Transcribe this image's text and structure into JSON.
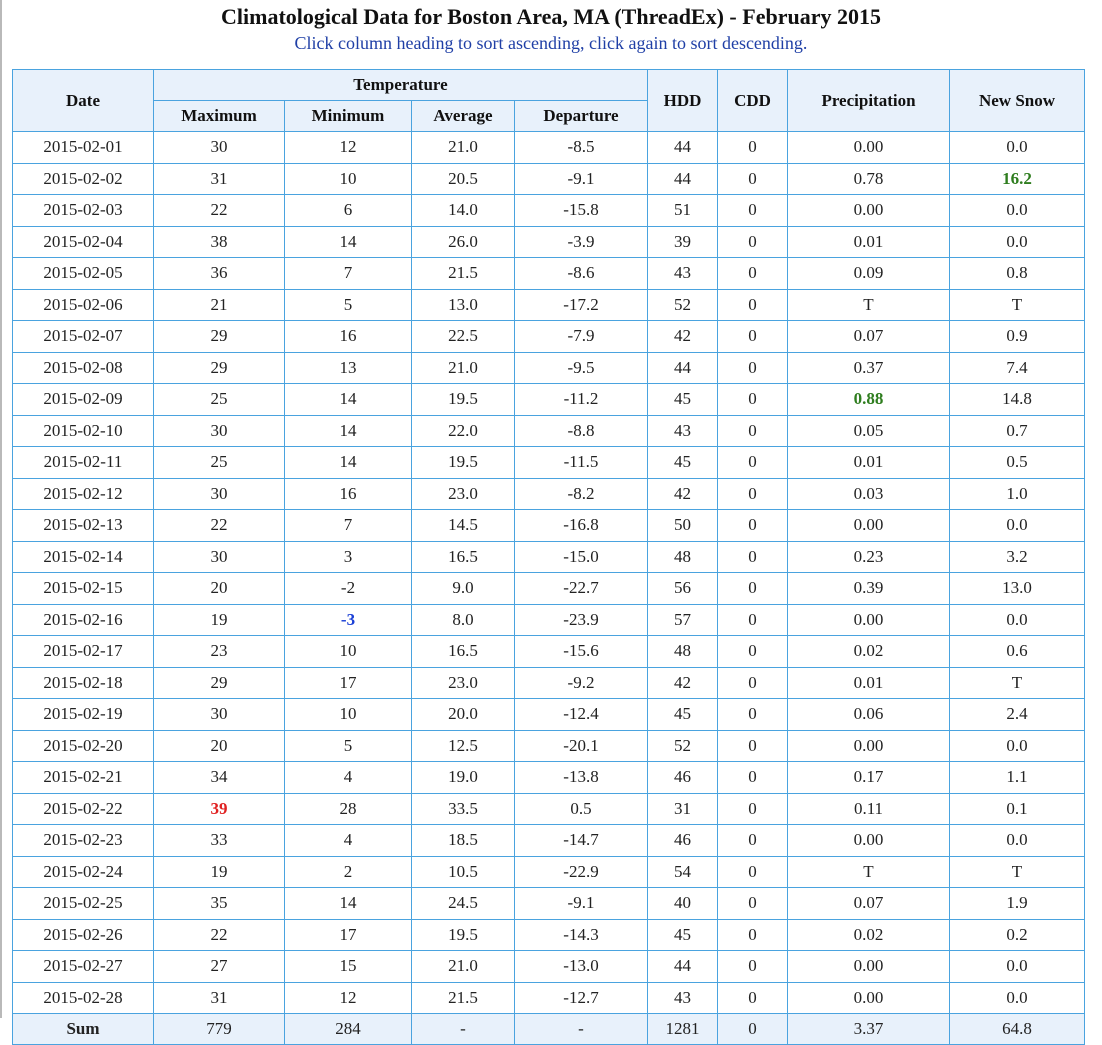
{
  "page": {
    "title": "Climatological Data for Boston Area, MA (ThreadEx) - February 2015",
    "subtitle": "Click column heading to sort ascending, click again to sort descending."
  },
  "headers": {
    "date": "Date",
    "temperature": "Temperature",
    "maximum": "Maximum",
    "minimum": "Minimum",
    "average": "Average",
    "departure": "Departure",
    "hdd": "HDD",
    "cdd": "CDD",
    "precipitation": "Precipitation",
    "new_snow": "New Snow"
  },
  "rows": [
    {
      "date": "2015-02-01",
      "max": "30",
      "min": "12",
      "avg": "21.0",
      "dep": "-8.5",
      "hdd": "44",
      "cdd": "0",
      "precip": "0.00",
      "snow": "0.0"
    },
    {
      "date": "2015-02-02",
      "max": "31",
      "min": "10",
      "avg": "20.5",
      "dep": "-9.1",
      "hdd": "44",
      "cdd": "0",
      "precip": "0.78",
      "snow": "16.2"
    },
    {
      "date": "2015-02-03",
      "max": "22",
      "min": "6",
      "avg": "14.0",
      "dep": "-15.8",
      "hdd": "51",
      "cdd": "0",
      "precip": "0.00",
      "snow": "0.0"
    },
    {
      "date": "2015-02-04",
      "max": "38",
      "min": "14",
      "avg": "26.0",
      "dep": "-3.9",
      "hdd": "39",
      "cdd": "0",
      "precip": "0.01",
      "snow": "0.0"
    },
    {
      "date": "2015-02-05",
      "max": "36",
      "min": "7",
      "avg": "21.5",
      "dep": "-8.6",
      "hdd": "43",
      "cdd": "0",
      "precip": "0.09",
      "snow": "0.8"
    },
    {
      "date": "2015-02-06",
      "max": "21",
      "min": "5",
      "avg": "13.0",
      "dep": "-17.2",
      "hdd": "52",
      "cdd": "0",
      "precip": "T",
      "snow": "T"
    },
    {
      "date": "2015-02-07",
      "max": "29",
      "min": "16",
      "avg": "22.5",
      "dep": "-7.9",
      "hdd": "42",
      "cdd": "0",
      "precip": "0.07",
      "snow": "0.9"
    },
    {
      "date": "2015-02-08",
      "max": "29",
      "min": "13",
      "avg": "21.0",
      "dep": "-9.5",
      "hdd": "44",
      "cdd": "0",
      "precip": "0.37",
      "snow": "7.4"
    },
    {
      "date": "2015-02-09",
      "max": "25",
      "min": "14",
      "avg": "19.5",
      "dep": "-11.2",
      "hdd": "45",
      "cdd": "0",
      "precip": "0.88",
      "snow": "14.8"
    },
    {
      "date": "2015-02-10",
      "max": "30",
      "min": "14",
      "avg": "22.0",
      "dep": "-8.8",
      "hdd": "43",
      "cdd": "0",
      "precip": "0.05",
      "snow": "0.7"
    },
    {
      "date": "2015-02-11",
      "max": "25",
      "min": "14",
      "avg": "19.5",
      "dep": "-11.5",
      "hdd": "45",
      "cdd": "0",
      "precip": "0.01",
      "snow": "0.5"
    },
    {
      "date": "2015-02-12",
      "max": "30",
      "min": "16",
      "avg": "23.0",
      "dep": "-8.2",
      "hdd": "42",
      "cdd": "0",
      "precip": "0.03",
      "snow": "1.0"
    },
    {
      "date": "2015-02-13",
      "max": "22",
      "min": "7",
      "avg": "14.5",
      "dep": "-16.8",
      "hdd": "50",
      "cdd": "0",
      "precip": "0.00",
      "snow": "0.0"
    },
    {
      "date": "2015-02-14",
      "max": "30",
      "min": "3",
      "avg": "16.5",
      "dep": "-15.0",
      "hdd": "48",
      "cdd": "0",
      "precip": "0.23",
      "snow": "3.2"
    },
    {
      "date": "2015-02-15",
      "max": "20",
      "min": "-2",
      "avg": "9.0",
      "dep": "-22.7",
      "hdd": "56",
      "cdd": "0",
      "precip": "0.39",
      "snow": "13.0"
    },
    {
      "date": "2015-02-16",
      "max": "19",
      "min": "-3",
      "avg": "8.0",
      "dep": "-23.9",
      "hdd": "57",
      "cdd": "0",
      "precip": "0.00",
      "snow": "0.0"
    },
    {
      "date": "2015-02-17",
      "max": "23",
      "min": "10",
      "avg": "16.5",
      "dep": "-15.6",
      "hdd": "48",
      "cdd": "0",
      "precip": "0.02",
      "snow": "0.6"
    },
    {
      "date": "2015-02-18",
      "max": "29",
      "min": "17",
      "avg": "23.0",
      "dep": "-9.2",
      "hdd": "42",
      "cdd": "0",
      "precip": "0.01",
      "snow": "T"
    },
    {
      "date": "2015-02-19",
      "max": "30",
      "min": "10",
      "avg": "20.0",
      "dep": "-12.4",
      "hdd": "45",
      "cdd": "0",
      "precip": "0.06",
      "snow": "2.4"
    },
    {
      "date": "2015-02-20",
      "max": "20",
      "min": "5",
      "avg": "12.5",
      "dep": "-20.1",
      "hdd": "52",
      "cdd": "0",
      "precip": "0.00",
      "snow": "0.0"
    },
    {
      "date": "2015-02-21",
      "max": "34",
      "min": "4",
      "avg": "19.0",
      "dep": "-13.8",
      "hdd": "46",
      "cdd": "0",
      "precip": "0.17",
      "snow": "1.1"
    },
    {
      "date": "2015-02-22",
      "max": "39",
      "min": "28",
      "avg": "33.5",
      "dep": "0.5",
      "hdd": "31",
      "cdd": "0",
      "precip": "0.11",
      "snow": "0.1"
    },
    {
      "date": "2015-02-23",
      "max": "33",
      "min": "4",
      "avg": "18.5",
      "dep": "-14.7",
      "hdd": "46",
      "cdd": "0",
      "precip": "0.00",
      "snow": "0.0"
    },
    {
      "date": "2015-02-24",
      "max": "19",
      "min": "2",
      "avg": "10.5",
      "dep": "-22.9",
      "hdd": "54",
      "cdd": "0",
      "precip": "T",
      "snow": "T"
    },
    {
      "date": "2015-02-25",
      "max": "35",
      "min": "14",
      "avg": "24.5",
      "dep": "-9.1",
      "hdd": "40",
      "cdd": "0",
      "precip": "0.07",
      "snow": "1.9"
    },
    {
      "date": "2015-02-26",
      "max": "22",
      "min": "17",
      "avg": "19.5",
      "dep": "-14.3",
      "hdd": "45",
      "cdd": "0",
      "precip": "0.02",
      "snow": "0.2"
    },
    {
      "date": "2015-02-27",
      "max": "27",
      "min": "15",
      "avg": "21.0",
      "dep": "-13.0",
      "hdd": "44",
      "cdd": "0",
      "precip": "0.00",
      "snow": "0.0"
    },
    {
      "date": "2015-02-28",
      "max": "31",
      "min": "12",
      "avg": "21.5",
      "dep": "-12.7",
      "hdd": "43",
      "cdd": "0",
      "precip": "0.00",
      "snow": "0.0"
    }
  ],
  "sum": {
    "label": "Sum",
    "max": "779",
    "min": "284",
    "avg": "-",
    "dep": "-",
    "hdd": "1281",
    "cdd": "0",
    "precip": "3.37",
    "snow": "64.8"
  },
  "highlights": {
    "max_red": {
      "row": 21,
      "col": "max",
      "color": "#e02020"
    },
    "min_blue": {
      "row": 15,
      "col": "min",
      "color": "#1a3fd6"
    },
    "precip_green": {
      "row": 8,
      "col": "precip",
      "color": "#2e7d1e"
    },
    "snow_green": {
      "row": 1,
      "col": "snow",
      "color": "#2e7d1e"
    }
  }
}
